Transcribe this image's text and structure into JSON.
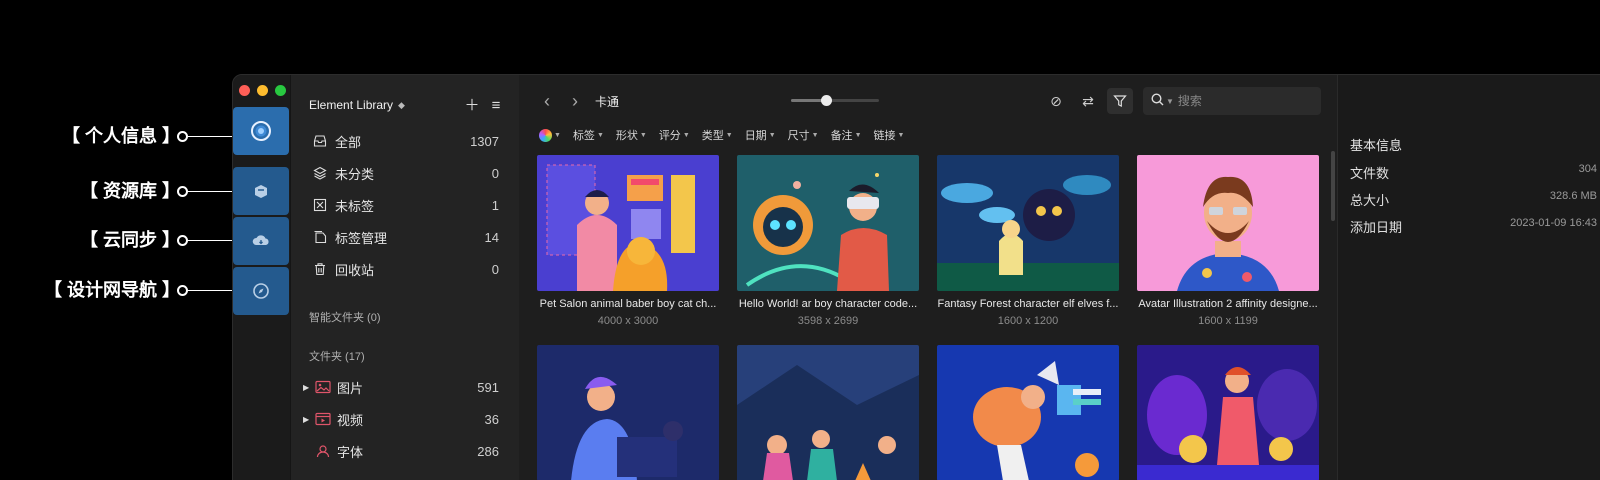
{
  "callouts": [
    {
      "label": "【 个人信息 】"
    },
    {
      "label": "【 资源库 】"
    },
    {
      "label": "【 云同步 】"
    },
    {
      "label": "【 设计网导航 】"
    }
  ],
  "sidebar": {
    "library_title": "Element Library",
    "nav": [
      {
        "label": "全部",
        "count": "1307"
      },
      {
        "label": "未分类",
        "count": "0"
      },
      {
        "label": "未标签",
        "count": "1"
      },
      {
        "label": "标签管理",
        "count": "14"
      },
      {
        "label": "回收站",
        "count": "0"
      }
    ],
    "smart_folders_label": "智能文件夹 (0)",
    "folders_label": "文件夹 (17)",
    "folders": [
      {
        "label": "图片",
        "count": "591",
        "icon": "image-folder-icon"
      },
      {
        "label": "视频",
        "count": "36",
        "icon": "video-folder-icon"
      },
      {
        "label": "字体",
        "count": "286",
        "icon": "font-folder-icon"
      }
    ]
  },
  "toolbar": {
    "folder_title": "卡通",
    "zoom_level": 0.4,
    "search_placeholder": "搜索"
  },
  "filters": [
    "标签",
    "形状",
    "评分",
    "类型",
    "日期",
    "尺寸",
    "备注",
    "链接"
  ],
  "items": [
    {
      "name": "Pet Salon animal baber boy cat ch...",
      "dims": "4000 x 3000"
    },
    {
      "name": "Hello World! ar boy character code...",
      "dims": "3598 x 2699"
    },
    {
      "name": "Fantasy Forest character elf elves f...",
      "dims": "1600 x 1200"
    },
    {
      "name": "Avatar Illustration 2 affinity designe...",
      "dims": "1600 x 1199"
    },
    {
      "name": "",
      "dims": ""
    },
    {
      "name": "",
      "dims": ""
    },
    {
      "name": "",
      "dims": ""
    },
    {
      "name": "",
      "dims": ""
    }
  ],
  "info": {
    "title": "基本信息",
    "rows": [
      {
        "label": "文件数",
        "value": "304"
      },
      {
        "label": "总大小",
        "value": "328.6 MB"
      },
      {
        "label": "添加日期",
        "value": "2023-01-09 16:43"
      }
    ]
  },
  "colors": {
    "rail_accent": "#2b6dad",
    "background": "#1e1e1e"
  }
}
